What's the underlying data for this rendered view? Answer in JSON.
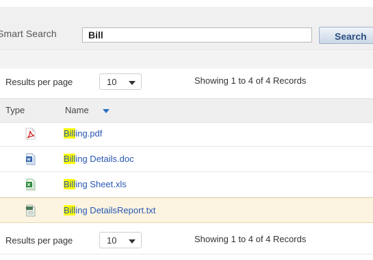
{
  "search": {
    "label": "Smart Search",
    "value": "Bill",
    "button_label": "Search"
  },
  "pager_top": {
    "label": "Results per page",
    "per_page": "10",
    "showing": "Showing 1 to 4 of 4 Records"
  },
  "pager_bottom": {
    "label": "Results per page",
    "per_page": "10",
    "showing": "Showing 1 to 4 of 4 Records"
  },
  "table": {
    "columns": {
      "type": "Type",
      "name": "Name"
    },
    "sort_indicator": "descending",
    "highlight_color": "#ffff00",
    "rows": [
      {
        "icon": "pdf-file-icon",
        "match": "Bill",
        "rest": "ing.pdf"
      },
      {
        "icon": "word-doc-icon",
        "match": "Bill",
        "rest": "ing Details.doc"
      },
      {
        "icon": "excel-xls-icon",
        "match": "Bill",
        "rest": "ing Sheet.xls"
      },
      {
        "icon": "text-file-icon",
        "match": "Bill",
        "rest": "ing DetailsReport.txt",
        "selected": true
      }
    ]
  }
}
